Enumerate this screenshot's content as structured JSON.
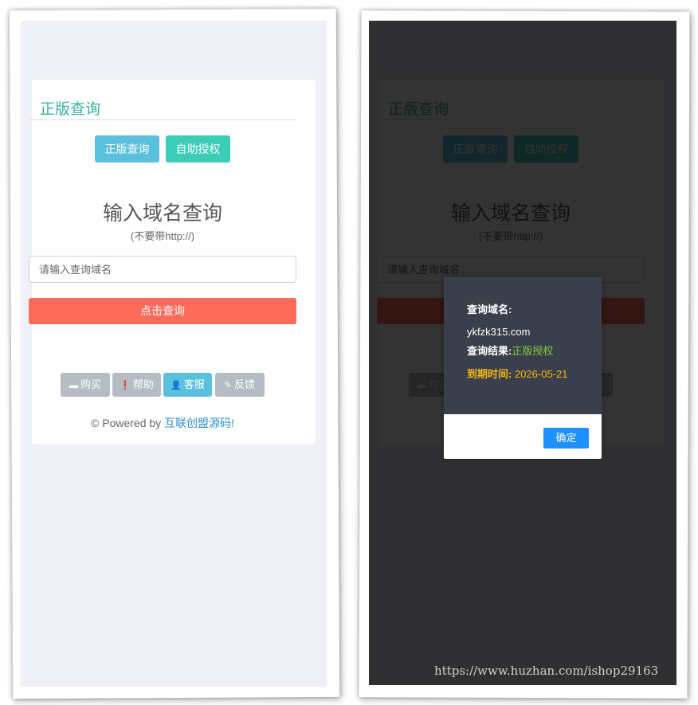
{
  "left_screen": {
    "card_title": "正版查询",
    "btn_genuine": "正版查询",
    "btn_auth": "自助授权",
    "heading": "输入域名查询",
    "subheading": "(不要带http://)",
    "input_placeholder": "请输入查询域名",
    "query_button": "点击查询",
    "footer_buttons": {
      "buy": "购买",
      "help": "帮助",
      "service": "客服",
      "feedback": "反馈"
    },
    "powered_prefix": "© Powered by ",
    "powered_link": "互联创盟源码!"
  },
  "right_screen": {
    "modal": {
      "domain_label": "查询域名:",
      "domain_value": "ykfzk315.com",
      "result_label": "查询结果:",
      "result_value": "正版授权",
      "expire_label": "到期时间:",
      "expire_value": "2026-05-21",
      "ok_button": "确定"
    }
  },
  "watermark": "https://www.huzhan.com/ishop29163",
  "colors": {
    "accent_teal": "#3ab09e",
    "btn_blue": "#5bc0de",
    "btn_teal": "#3ccdb8",
    "query_red": "#ff6b5b",
    "footer_gray": "#b5bcc3",
    "modal_dark": "#3a3f4b",
    "result_green": "#7ccd3a",
    "expire_yellow": "#f5b90f",
    "ok_blue": "#1e90ff"
  }
}
